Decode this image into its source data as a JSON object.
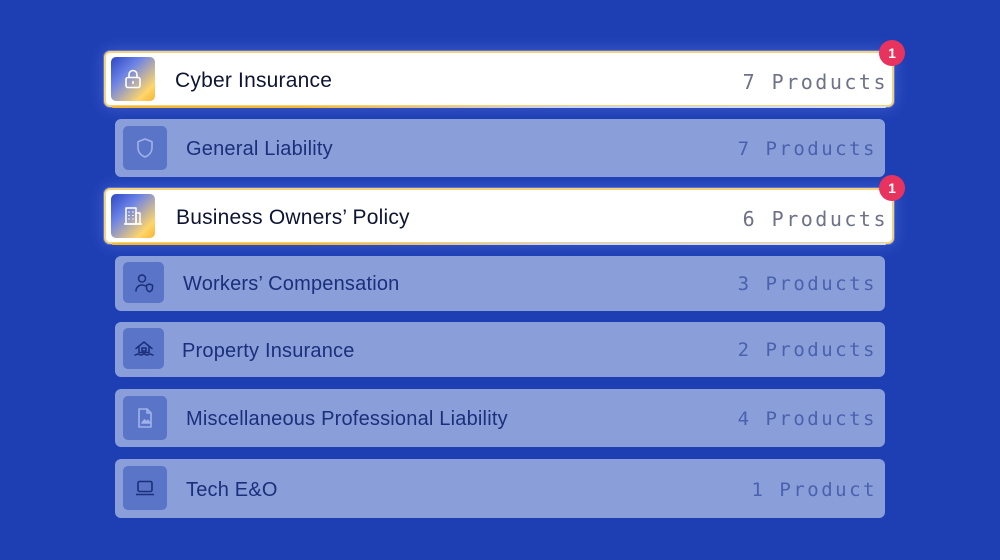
{
  "colors": {
    "background": "#1e3fb4",
    "row_dim": "#8a9fda",
    "row_highlight": "#ffffff",
    "badge": "#e8335e",
    "highlight_border": "#f3d27a"
  },
  "items": [
    {
      "label": "Cyber Insurance",
      "count": "7 Products",
      "icon": "lock-icon",
      "highlighted": true,
      "badge": "1"
    },
    {
      "label": "General Liability",
      "count": "7 Products",
      "icon": "shield-icon",
      "highlighted": false
    },
    {
      "label": "Business Owners’ Policy",
      "count": "6 Products",
      "icon": "building-icon",
      "highlighted": true,
      "badge": "1"
    },
    {
      "label": "Workers’ Compensation",
      "count": "3 Products",
      "icon": "user-shield-icon",
      "highlighted": false
    },
    {
      "label": "Property Insurance",
      "count": "2 Products",
      "icon": "house-flood-icon",
      "highlighted": false
    },
    {
      "label": "Miscellaneous Professional Liability",
      "count": "4 Products",
      "icon": "document-icon",
      "highlighted": false
    },
    {
      "label": "Tech E&O",
      "count": "1 Product",
      "icon": "laptop-icon",
      "highlighted": false
    }
  ]
}
